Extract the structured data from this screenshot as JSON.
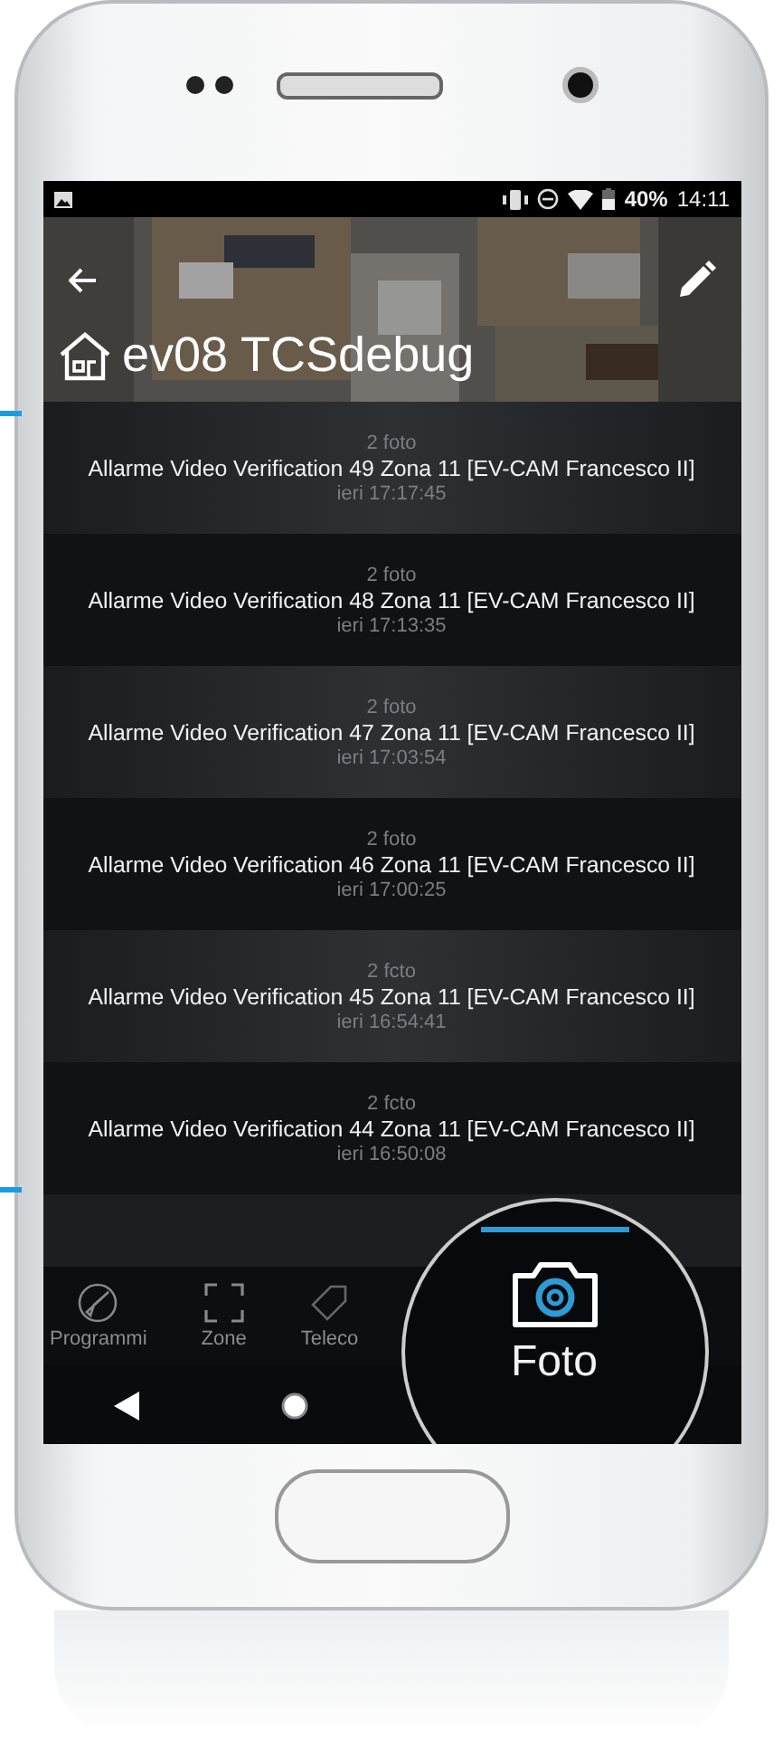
{
  "status_bar": {
    "battery": "40%",
    "time": "14:11"
  },
  "header": {
    "title": "ev08 TCSdebug"
  },
  "alarms": [
    {
      "count": "2 foto",
      "title": "Allarme Video Verification 49 Zona 11 [EV-CAM Francesco II]",
      "time": "ieri 17:17:45"
    },
    {
      "count": "2 foto",
      "title": "Allarme Video Verification 48 Zona 11 [EV-CAM Francesco II]",
      "time": "ieri 17:13:35"
    },
    {
      "count": "2 foto",
      "title": "Allarme Video Verification 47 Zona 11 [EV-CAM Francesco II]",
      "time": "ieri 17:03:54"
    },
    {
      "count": "2 foto",
      "title": "Allarme Video Verification 46 Zona 11 [EV-CAM Francesco II]",
      "time": "ieri 17:00:25"
    },
    {
      "count": "2 fcto",
      "title": "Allarme Video Verification 45 Zona 11 [EV-CAM Francesco II]",
      "time": "ieri 16:54:41"
    },
    {
      "count": "2 fcto",
      "title": "Allarme Video Verification 44 Zona 11 [EV-CAM Francesco II]",
      "time": "ieri 16:50:08"
    }
  ],
  "tabs": [
    {
      "label": "Programmi",
      "kind": "plane",
      "selected": false
    },
    {
      "label": "Zone",
      "kind": "zone",
      "selected": false
    },
    {
      "label": "Teleco",
      "kind": "tag",
      "selected": false
    },
    {
      "label": "Foto",
      "kind": "camera",
      "selected": true
    }
  ]
}
